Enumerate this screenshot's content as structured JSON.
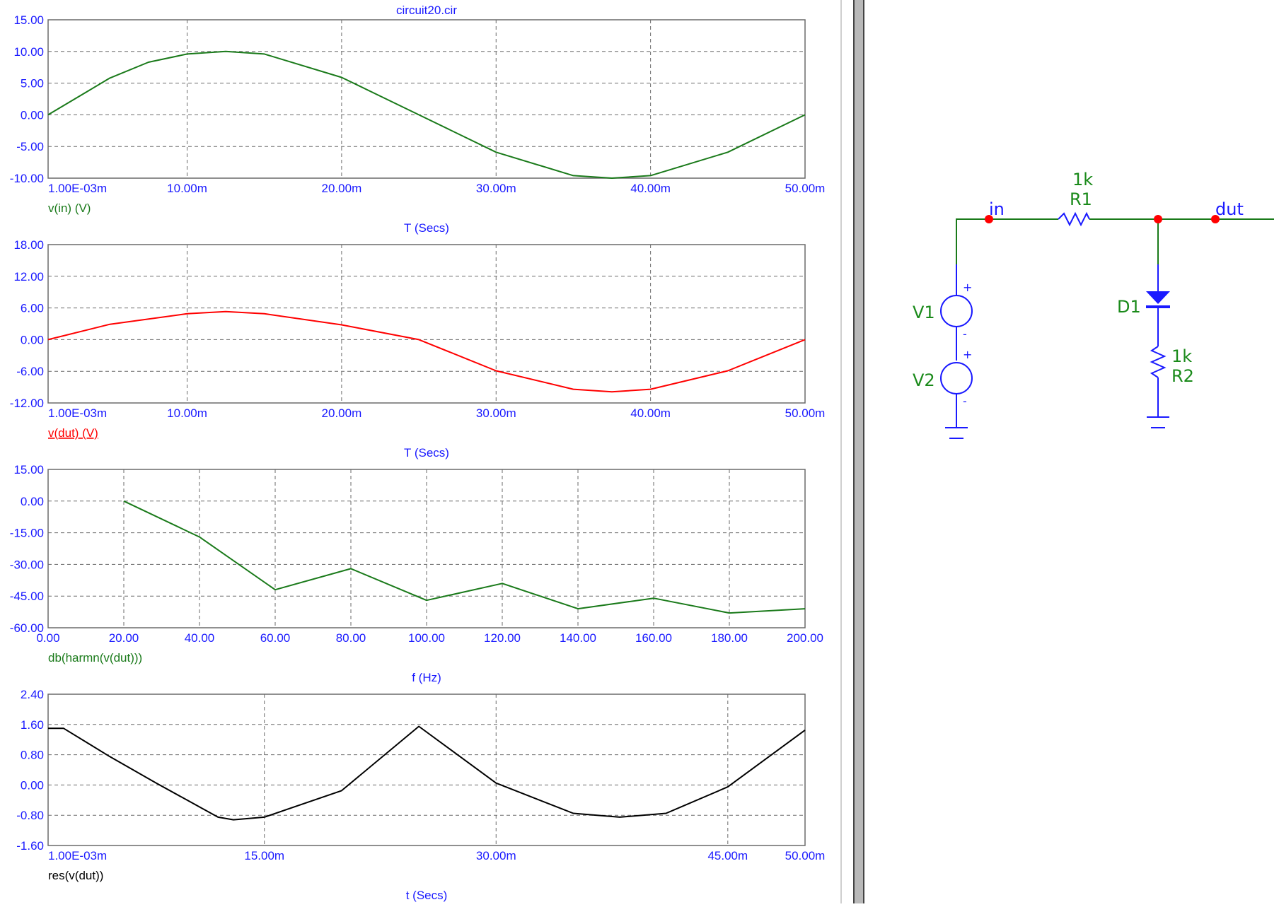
{
  "window_title": "circuit20.cir",
  "colors": {
    "axis_text": "#1a1aff",
    "grid": "#6a6a6a",
    "green": "#1a7a1a",
    "red": "#ff0000",
    "black": "#000000"
  },
  "chart_data": [
    {
      "type": "line",
      "title": "circuit20.cir",
      "xlabel": "T (Secs)",
      "series_label": "v(in) (V)",
      "series": [
        {
          "name": "v(in) (V)",
          "color": "#1a7a1a",
          "x": [
            0.001,
            0.005,
            0.0075,
            0.01,
            0.0125,
            0.015,
            0.02,
            0.025,
            0.03,
            0.035,
            0.0375,
            0.04,
            0.045,
            0.05
          ],
          "y": [
            0,
            5.8,
            8.3,
            9.6,
            10,
            9.6,
            5.9,
            0,
            -5.9,
            -9.6,
            -10,
            -9.6,
            -5.9,
            0
          ]
        }
      ],
      "xticks": [
        {
          "v": 0.001,
          "label": "1.00E-03m"
        },
        {
          "v": 0.01,
          "label": "10.00m"
        },
        {
          "v": 0.02,
          "label": "20.00m"
        },
        {
          "v": 0.03,
          "label": "30.00m"
        },
        {
          "v": 0.04,
          "label": "40.00m"
        },
        {
          "v": 0.05,
          "label": "50.00m"
        }
      ],
      "yticks": [
        "15.00",
        "10.00",
        "5.00",
        "0.00",
        "-5.00",
        "-10.00"
      ],
      "xlim": [
        0.001,
        0.05
      ],
      "ylim": [
        -10,
        15
      ],
      "grid": true
    },
    {
      "type": "line",
      "xlabel": "T (Secs)",
      "series_label": "v(dut) (V)",
      "series": [
        {
          "name": "v(dut) (V)",
          "color": "#ff0000",
          "x": [
            0.001,
            0.005,
            0.01,
            0.0125,
            0.015,
            0.02,
            0.025,
            0.03,
            0.035,
            0.0375,
            0.04,
            0.045,
            0.05
          ],
          "y": [
            0,
            2.9,
            4.9,
            5.3,
            4.9,
            2.8,
            0,
            -5.9,
            -9.4,
            -9.9,
            -9.4,
            -5.9,
            0
          ]
        }
      ],
      "xticks": [
        {
          "v": 0.001,
          "label": "1.00E-03m"
        },
        {
          "v": 0.01,
          "label": "10.00m"
        },
        {
          "v": 0.02,
          "label": "20.00m"
        },
        {
          "v": 0.03,
          "label": "30.00m"
        },
        {
          "v": 0.04,
          "label": "40.00m"
        },
        {
          "v": 0.05,
          "label": "50.00m"
        }
      ],
      "yticks": [
        "18.00",
        "12.00",
        "6.00",
        "0.00",
        "-6.00",
        "-12.00"
      ],
      "xlim": [
        0.001,
        0.05
      ],
      "ylim": [
        -12,
        18
      ],
      "grid": true
    },
    {
      "type": "line",
      "xlabel": "f (Hz)",
      "series_label": "db(harmn(v(dut)))",
      "series": [
        {
          "name": "db(harmn(v(dut)))",
          "color": "#1a7a1a",
          "x": [
            20,
            40,
            60,
            80,
            100,
            120,
            140,
            160,
            180,
            200
          ],
          "y": [
            0,
            -17,
            -42,
            -32,
            -47,
            -39,
            -51,
            -46,
            -53,
            -51
          ]
        }
      ],
      "xticks": [
        {
          "v": 0,
          "label": "0.00"
        },
        {
          "v": 20,
          "label": "20.00"
        },
        {
          "v": 40,
          "label": "40.00"
        },
        {
          "v": 60,
          "label": "60.00"
        },
        {
          "v": 80,
          "label": "80.00"
        },
        {
          "v": 100,
          "label": "100.00"
        },
        {
          "v": 120,
          "label": "120.00"
        },
        {
          "v": 140,
          "label": "140.00"
        },
        {
          "v": 160,
          "label": "160.00"
        },
        {
          "v": 180,
          "label": "180.00"
        },
        {
          "v": 200,
          "label": "200.00"
        }
      ],
      "yticks": [
        "15.00",
        "0.00",
        "-15.00",
        "-30.00",
        "-45.00",
        "-60.00"
      ],
      "xlim": [
        0,
        200
      ],
      "ylim": [
        -60,
        15
      ],
      "grid": true
    },
    {
      "type": "line",
      "xlabel": "t (Secs)",
      "series_label": "res(v(dut))",
      "series": [
        {
          "name": "res(v(dut))",
          "color": "#000000",
          "x": [
            0.001,
            0.002,
            0.005,
            0.008,
            0.01,
            0.012,
            0.013,
            0.015,
            0.02,
            0.025,
            0.03,
            0.035,
            0.038,
            0.041,
            0.045,
            0.05
          ],
          "y": [
            1.5,
            1.5,
            0.75,
            0.05,
            -0.4,
            -0.85,
            -0.92,
            -0.85,
            -0.15,
            1.55,
            0.05,
            -0.75,
            -0.85,
            -0.75,
            -0.05,
            1.45
          ]
        }
      ],
      "xticks": [
        {
          "v": 0.001,
          "label": "1.00E-03m"
        },
        {
          "v": 0.015,
          "label": "15.00m"
        },
        {
          "v": 0.03,
          "label": "30.00m"
        },
        {
          "v": 0.045,
          "label": "45.00m"
        },
        {
          "v": 0.05,
          "label": "50.00m"
        }
      ],
      "yticks": [
        "2.40",
        "1.60",
        "0.80",
        "0.00",
        "-0.80",
        "-1.60"
      ],
      "xlim": [
        0.001,
        0.05
      ],
      "ylim": [
        -1.6,
        2.4
      ],
      "grid": true
    }
  ],
  "schematic": {
    "nodes": [
      "in",
      "dut"
    ],
    "components": [
      {
        "ref": "R1",
        "value": "1k"
      },
      {
        "ref": "R2",
        "value": "1k"
      },
      {
        "ref": "D1",
        "value": ""
      },
      {
        "ref": "V1",
        "value": ""
      },
      {
        "ref": "V2",
        "value": ""
      }
    ],
    "plus": "+",
    "minus": "-"
  }
}
